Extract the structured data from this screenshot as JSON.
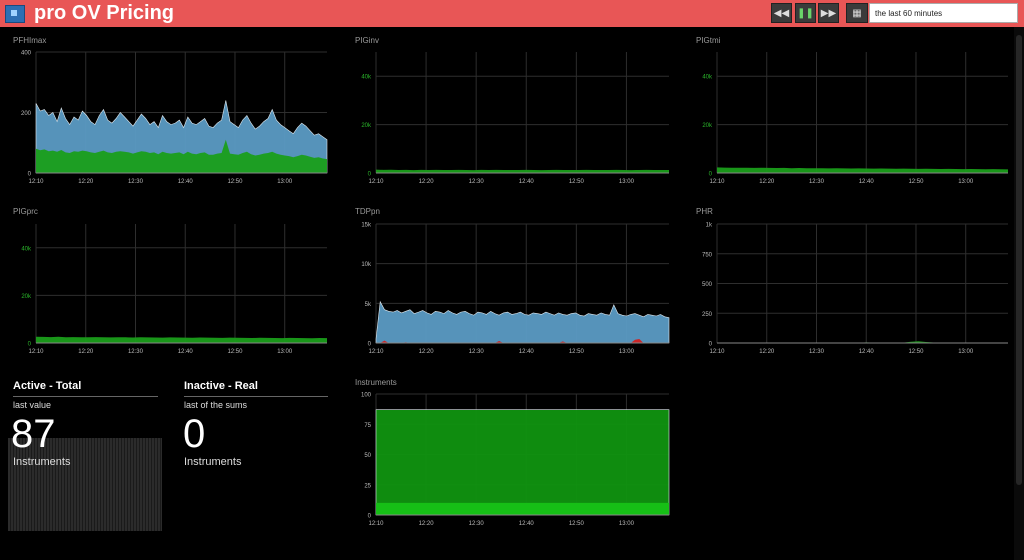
{
  "header": {
    "title": "pro OV Pricing",
    "time_range": "the last 60 minutes",
    "buttons": {
      "rewind": "◀◀",
      "pause": "❚❚",
      "forward": "▶▶",
      "calendar": "▦"
    }
  },
  "panels": [
    {
      "title": "PFHImax",
      "chart_data": {
        "type": "area",
        "ylim": [
          0,
          400
        ],
        "yticks": [
          {
            "v": 0,
            "label": "0"
          },
          {
            "v": 200,
            "label": "200"
          },
          {
            "v": 400,
            "label": "400"
          }
        ],
        "xticks": [
          "12:10",
          "12:20",
          "12:30",
          "12:40",
          "12:50",
          "13:00"
        ],
        "ytick_color": "#bbbbbb",
        "series": [
          {
            "color": "#5b9bc4",
            "values": [
              230,
              205,
              210,
              190,
              200,
              170,
              215,
              180,
              160,
              185,
              175,
              205,
              190,
              170,
              160,
              190,
              210,
              175,
              165,
              180,
              200,
              185,
              170,
              155,
              175,
              195,
              180,
              160,
              170,
              150,
              190,
              170,
              160,
              165,
              175,
              150,
              185,
              165,
              160,
              170,
              180,
              155,
              150,
              165,
              175,
              240,
              170,
              160,
              150,
              175,
              190,
              165,
              145,
              155,
              170,
              180,
              210,
              175,
              160,
              150,
              140,
              130,
              150,
              165,
              155,
              140,
              125,
              130,
              120,
              110
            ]
          },
          {
            "color": "#1a9e1a",
            "values": [
              80,
              75,
              78,
              72,
              74,
              70,
              76,
              68,
              66,
              72,
              70,
              74,
              72,
              68,
              66,
              70,
              74,
              68,
              66,
              70,
              72,
              70,
              68,
              64,
              68,
              72,
              70,
              66,
              68,
              62,
              70,
              66,
              64,
              66,
              68,
              62,
              70,
              64,
              62,
              66,
              68,
              60,
              60,
              64,
              66,
              110,
              64,
              62,
              60,
              66,
              70,
              62,
              58,
              60,
              64,
              66,
              70,
              64,
              60,
              58,
              56,
              52,
              56,
              60,
              58,
              54,
              50,
              52,
              48,
              46
            ]
          }
        ]
      }
    },
    {
      "title": "PIGinv",
      "chart_data": {
        "type": "area",
        "ylim": [
          0,
          50000
        ],
        "yticks": [
          {
            "v": 0,
            "label": "0"
          },
          {
            "v": 20000,
            "label": "20k"
          },
          {
            "v": 40000,
            "label": "40k"
          }
        ],
        "xticks": [
          "12:10",
          "12:20",
          "12:30",
          "12:40",
          "12:50",
          "13:00"
        ],
        "ytick_color": "#2bb82b",
        "series": [
          {
            "color": "#1a9e1a",
            "values": [
              1400,
              1300,
              1350,
              1250,
              1300,
              1200,
              1280,
              1250,
              1300,
              1220,
              1260,
              1300,
              1250,
              1200,
              1280,
              1240,
              1300,
              1260,
              1220,
              1250,
              1280,
              1240,
              1200,
              1260,
              1290,
              1250,
              1220,
              1240,
              1280,
              1260,
              1230,
              1250,
              1270,
              1240,
              1200,
              1250,
              1280,
              1260,
              1230,
              1250
            ]
          }
        ]
      }
    },
    {
      "title": "PIGtmi",
      "chart_data": {
        "type": "area",
        "ylim": [
          0,
          50000
        ],
        "yticks": [
          {
            "v": 0,
            "label": "0"
          },
          {
            "v": 20000,
            "label": "20k"
          },
          {
            "v": 40000,
            "label": "40k"
          }
        ],
        "xticks": [
          "12:10",
          "12:20",
          "12:30",
          "12:40",
          "12:50",
          "13:00"
        ],
        "ytick_color": "#2bb82b",
        "series": [
          {
            "color": "#1a9e1a",
            "values": [
              2300,
              2250,
              2200,
              2150,
              2200,
              2100,
              2150,
              2100,
              2050,
              2100,
              2000,
              2050,
              2000,
              1950,
              2000,
              1900,
              1950,
              1900,
              1850,
              1900,
              1850,
              1800,
              1850,
              1800,
              1750,
              1800,
              1750,
              1700,
              1750,
              1700,
              1650,
              1700,
              1650,
              1600,
              1650,
              1600,
              1550,
              1600,
              1550,
              1500
            ]
          }
        ]
      }
    },
    {
      "title": "PIGprc",
      "chart_data": {
        "type": "area",
        "ylim": [
          0,
          50000
        ],
        "yticks": [
          {
            "v": 0,
            "label": "0"
          },
          {
            "v": 20000,
            "label": "20k"
          },
          {
            "v": 40000,
            "label": "40k"
          }
        ],
        "xticks": [
          "12:10",
          "12:20",
          "12:30",
          "12:40",
          "12:50",
          "13:00"
        ],
        "ytick_color": "#2bb82b",
        "series": [
          {
            "color": "#1a9e1a",
            "values": [
              2600,
              2550,
              2500,
              2600,
              2450,
              2500,
              2400,
              2450,
              2500,
              2400,
              2350,
              2450,
              2400,
              2300,
              2400,
              2350,
              2300,
              2250,
              2350,
              2300,
              2250,
              2200,
              2300,
              2250,
              2200,
              2150,
              2250,
              2200,
              2150,
              2100,
              2200,
              2150,
              2100,
              2050,
              2150,
              2100,
              2050,
              2000,
              2100,
              2050
            ]
          }
        ]
      }
    },
    {
      "title": "TDPpn",
      "chart_data": {
        "type": "area",
        "ylim": [
          0,
          15000
        ],
        "yticks": [
          {
            "v": 0,
            "label": "0"
          },
          {
            "v": 5000,
            "label": "5k"
          },
          {
            "v": 10000,
            "label": "10k"
          },
          {
            "v": 15000,
            "label": "15k"
          }
        ],
        "xticks": [
          "12:10",
          "12:20",
          "12:30",
          "12:40",
          "12:50",
          "13:00"
        ],
        "ytick_color": "#bbbbbb",
        "series": [
          {
            "color": "#5b9bc4",
            "values": [
              500,
              5200,
              4200,
              4000,
              3900,
              4100,
              3800,
              4000,
              4200,
              3700,
              3900,
              4100,
              3800,
              3600,
              4000,
              3900,
              3700,
              4100,
              3800,
              3600,
              3900,
              4000,
              3700,
              3500,
              3900,
              3800,
              3600,
              4000,
              3700,
              3500,
              3800,
              3900,
              3600,
              3700,
              3900,
              3600,
              3500,
              3800,
              3700,
              3600,
              3900,
              3700,
              3500,
              3800,
              3600,
              3500,
              3700,
              3800,
              3500,
              3400,
              3700,
              3600,
              3500,
              3800,
              3600,
              3500,
              4800,
              3700,
              3500,
              3400,
              3600,
              3700,
              3500,
              3300,
              3600,
              3500,
              3400,
              3600,
              3300,
              3200
            ]
          },
          {
            "color": "#d21f1f",
            "values": [
              0,
              0,
              300,
              0,
              0,
              0,
              0,
              100,
              0,
              0,
              0,
              0,
              0,
              0,
              0,
              0,
              0,
              0,
              0,
              0,
              0,
              0,
              0,
              0,
              0,
              0,
              0,
              0,
              0,
              250,
              0,
              0,
              0,
              0,
              0,
              0,
              0,
              0,
              0,
              0,
              0,
              0,
              0,
              0,
              200,
              0,
              0,
              0,
              0,
              0,
              0,
              0,
              0,
              0,
              0,
              0,
              0,
              0,
              0,
              0,
              0,
              400,
              500,
              0,
              0,
              0,
              0,
              0,
              0,
              0
            ]
          }
        ]
      }
    },
    {
      "title": "PHR",
      "chart_data": {
        "type": "area",
        "ylim": [
          0,
          1000
        ],
        "yticks": [
          {
            "v": 0,
            "label": "0"
          },
          {
            "v": 250,
            "label": "250"
          },
          {
            "v": 500,
            "label": "500"
          },
          {
            "v": 750,
            "label": "750"
          },
          {
            "v": 1000,
            "label": "1k"
          }
        ],
        "xticks": [
          "12:10",
          "12:20",
          "12:30",
          "12:40",
          "12:50",
          "13:00"
        ],
        "ytick_color": "#bbbbbb",
        "series": [
          {
            "color": "#1a9e1a",
            "values": [
              2,
              3,
              2,
              4,
              2,
              3,
              2,
              2,
              3,
              2,
              2,
              3,
              2,
              2,
              3,
              2,
              2,
              3,
              2,
              2,
              5,
              3,
              2,
              4,
              2,
              3,
              10,
              15,
              8,
              4,
              3,
              2,
              3,
              2,
              2,
              3,
              2,
              2,
              3,
              2
            ]
          }
        ]
      }
    },
    {
      "title": "Instruments",
      "chart_data": {
        "type": "area",
        "ylim": [
          0,
          100
        ],
        "yticks": [
          {
            "v": 0,
            "label": "0"
          },
          {
            "v": 25,
            "label": "25"
          },
          {
            "v": 50,
            "label": "50"
          },
          {
            "v": 75,
            "label": "75"
          },
          {
            "v": 100,
            "label": "100"
          }
        ],
        "xticks": [
          "12:10",
          "12:20",
          "12:30",
          "12:40",
          "12:50",
          "13:00"
        ],
        "ytick_color": "#bbbbbb",
        "series": [
          {
            "color": "#109410",
            "values": [
              87,
              87
            ]
          },
          {
            "color": "#17c217",
            "values": [
              10,
              10
            ]
          }
        ]
      }
    }
  ],
  "stats": [
    {
      "title": "Active - Total",
      "subtitle": "last value",
      "value": "87",
      "unit": "Instruments"
    },
    {
      "title": "Inactive - Real",
      "subtitle": "last of the sums",
      "value": "0",
      "unit": "Instruments"
    }
  ]
}
